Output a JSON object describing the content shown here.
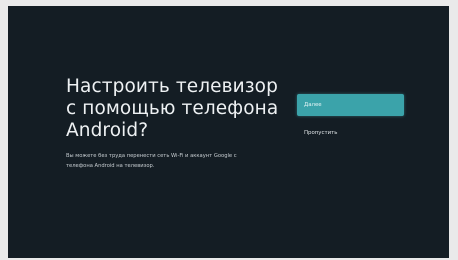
{
  "screen": {
    "title_lines": [
      "Настроить телевизор",
      "с помощью телефона",
      "Android?"
    ],
    "description_lines": [
      "Вы можете без труда перенести сеть Wi-Fi и аккаунт Google с",
      "телефона Android на телевизор."
    ]
  },
  "actions": {
    "next_label": "Далее",
    "skip_label": "Пропустить"
  },
  "colors": {
    "background": "#141d24",
    "accent": "#3ba3aa",
    "text": "#eef1f3"
  }
}
